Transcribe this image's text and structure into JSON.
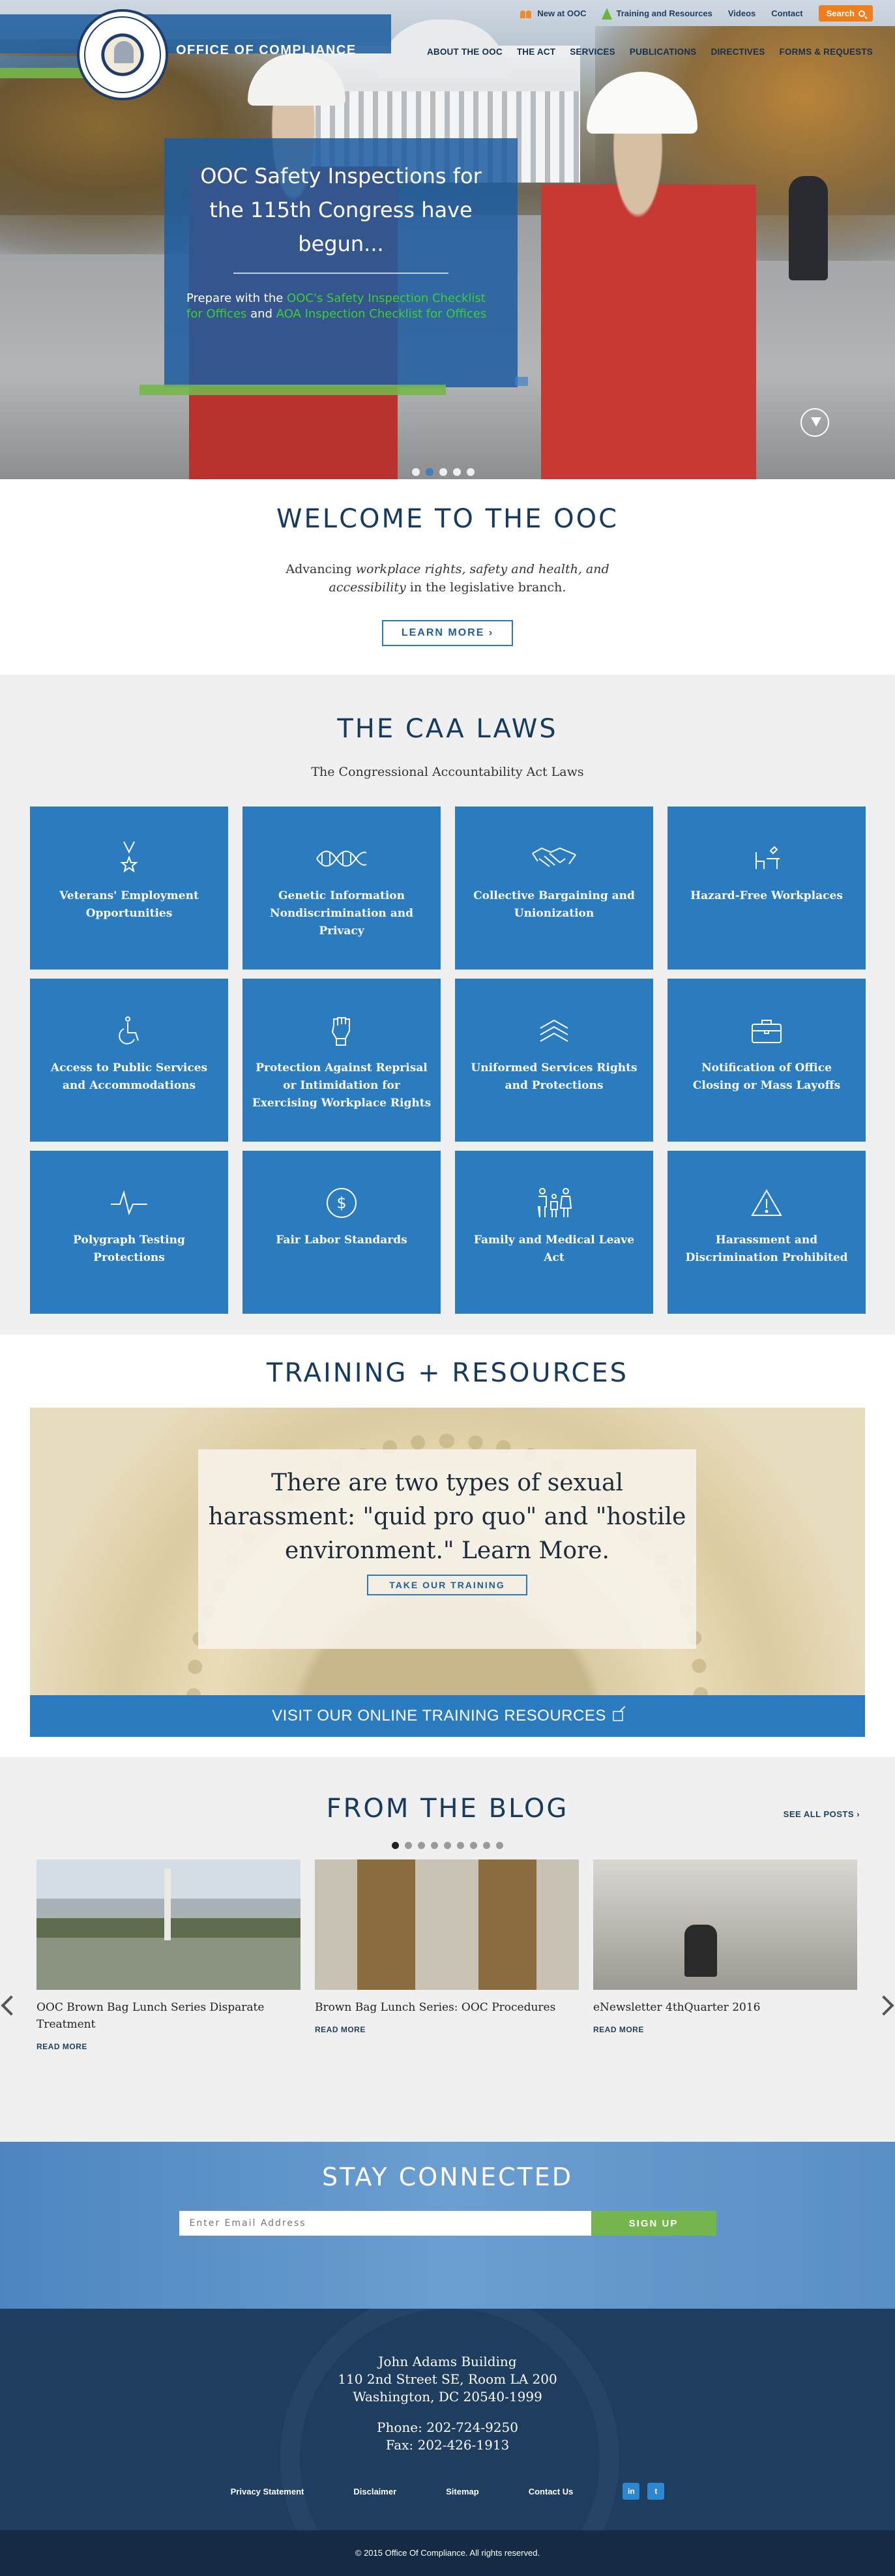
{
  "header": {
    "site_title": "OFFICE OF COMPLIANCE",
    "logo_alt": "OFFICE OF COMPLIANCE UNITED STATES CONGRESS",
    "utility_nav": [
      {
        "label": "New at OOC",
        "icon": "people-icon"
      },
      {
        "label": "Training and Resources",
        "icon": "cone-icon"
      },
      {
        "label": "Videos"
      },
      {
        "label": "Contact"
      }
    ],
    "search_label": "Search",
    "main_nav": [
      "ABOUT THE OOC",
      "THE ACT",
      "SERVICES",
      "PUBLICATIONS",
      "DIRECTIVES",
      "FORMS & REQUESTS"
    ]
  },
  "hero": {
    "headline": "OOC Safety Inspections for the 115th Congress have begun...",
    "body_prefix": "Prepare with the ",
    "link1": "OOC's Safety Inspection Checklist for Offices",
    "body_mid": " and ",
    "link2": "AOA Inspection Checklist for Offices",
    "slide_count": 5,
    "active_slide": 1
  },
  "welcome": {
    "title": "WELCOME TO THE OOC",
    "tagline_1": "Advancing ",
    "tagline_em1": "workplace rights, safety and health, and accessibility",
    "tagline_2": " in the legislative branch.",
    "button": "LEARN MORE"
  },
  "caa": {
    "title": "THE CAA LAWS",
    "subtitle": "The Congressional Accountability Act Laws",
    "laws": [
      {
        "label": "Veterans' Employment Opportunities",
        "icon": "medal-star-icon"
      },
      {
        "label": "Genetic Information Nondiscrimination and Privacy",
        "icon": "dna-icon"
      },
      {
        "label": "Collective Bargaining and Unionization",
        "icon": "handshake-icon"
      },
      {
        "label": "Hazard-Free Workplaces",
        "icon": "desk-chair-icon"
      },
      {
        "label": "Access to Public Services and Accommodations",
        "icon": "wheelchair-icon"
      },
      {
        "label": "Protection Against Reprisal or Intimidation for Exercising Workplace Rights",
        "icon": "raised-fist-icon"
      },
      {
        "label": "Uniformed Services Rights and Protections",
        "icon": "chevron-rank-icon"
      },
      {
        "label": "Notification of Office Closing or Mass Layoffs",
        "icon": "briefcase-icon"
      },
      {
        "label": "Polygraph Testing Protections",
        "icon": "pulse-line-icon"
      },
      {
        "label": "Fair Labor Standards",
        "icon": "dollar-circle-icon"
      },
      {
        "label": "Family and Medical Leave Act",
        "icon": "family-icon"
      },
      {
        "label": "Harassment and Discrimination Prohibited",
        "icon": "warning-triangle-icon"
      }
    ]
  },
  "training": {
    "title": "TRAINING + RESOURCES",
    "quote": "There are two types of sexual harassment: \"quid pro quo\" and \"hostile environment.\" Learn More.",
    "button": "TAKE OUR TRAINING",
    "visit_label": "VISIT OUR ONLINE TRAINING RESOURCES"
  },
  "blog": {
    "title": "FROM THE BLOG",
    "see_all": "SEE ALL POSTS",
    "dot_count": 9,
    "active_dot": 0,
    "posts": [
      {
        "title": "OOC Brown Bag Lunch Series Disparate Treatment",
        "more": "READ MORE"
      },
      {
        "title": "Brown Bag Lunch Series: OOC Procedures",
        "more": "READ MORE"
      },
      {
        "title": "eNewsletter 4thQuarter 2016",
        "more": "READ MORE"
      }
    ]
  },
  "stay": {
    "title": "STAY CONNECTED",
    "email_placeholder": "Enter Email Address",
    "signup": "SIGN UP"
  },
  "footer": {
    "address_line1": "John Adams Building",
    "address_line2": "110 2nd Street SE, Room LA 200",
    "address_line3": "Washington, DC 20540-1999",
    "phone": "Phone: 202-724-9250",
    "fax": "Fax: 202-426-1913",
    "links": [
      "Privacy Statement",
      "Disclaimer",
      "Sitemap",
      "Contact Us"
    ],
    "social": [
      "in",
      "t"
    ],
    "copyright": "© 2015 Office Of Compliance. All rights reserved."
  },
  "colors": {
    "brand_blue": "#2b7bbf",
    "navy": "#1e3d5f",
    "accent_green": "#74b64d",
    "search_orange": "#f07d1c",
    "link_green": "#3ccf30"
  }
}
